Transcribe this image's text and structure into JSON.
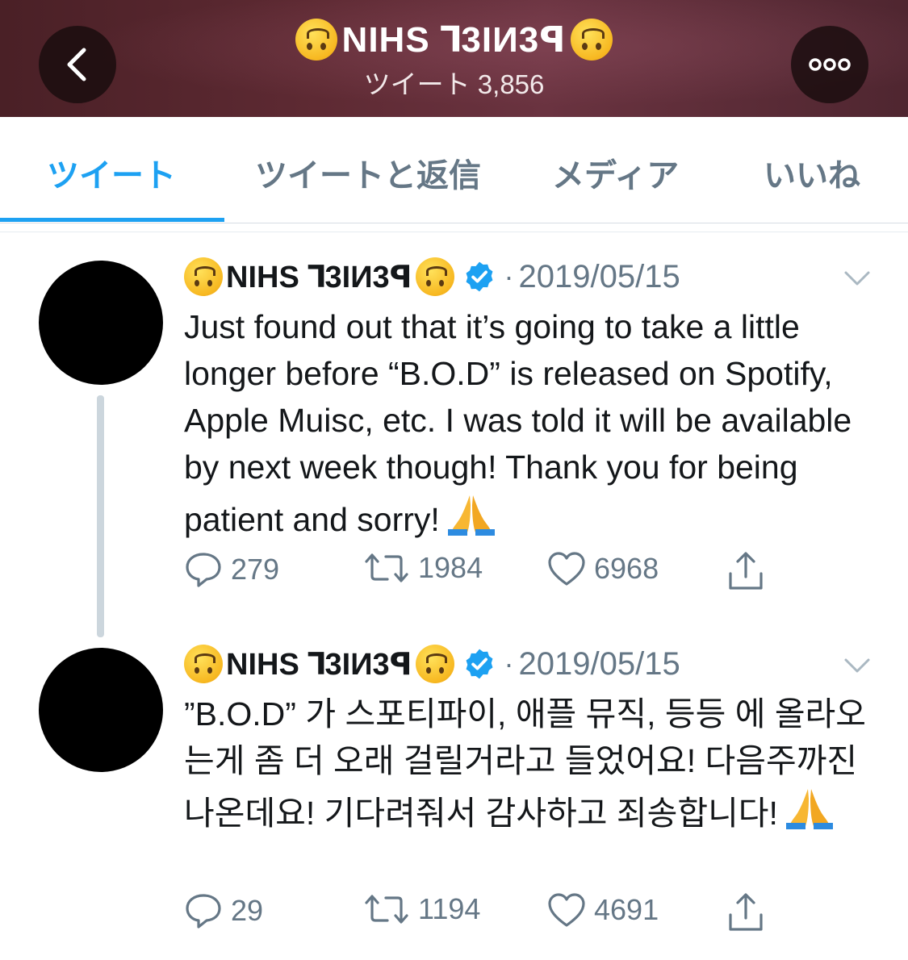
{
  "header": {
    "display_name": "NIHS ꓶ3IИ3ꟼ",
    "subtitle": "ツイート 3,856"
  },
  "tabs": [
    {
      "label": "ツイート",
      "active": true
    },
    {
      "label": "ツイートと返信",
      "active": false
    },
    {
      "label": "メディア",
      "active": false
    },
    {
      "label": "いいね",
      "active": false
    }
  ],
  "tweets": [
    {
      "name": "NIHS ꓶ3IИ3ꟼ",
      "separator": "·",
      "date": "2019/05/15",
      "text": "Just found out that it’s going to take a little longer before “B.O.D” is released on Spotify, Apple Muisc, etc. I was told it will be available by next week though! Thank you for being patient and sorry!",
      "replies": "279",
      "retweets": "1984",
      "likes": "6968"
    },
    {
      "name": "NIHS ꓶ3IИ3ꟼ",
      "separator": "·",
      "date": "2019/05/15",
      "text": "”B.O.D” 가 스포티파이, 애플 뮤직, 등등 에 올라오는게 좀 더 오래 걸릴거라고 들었어요! 다음주까진 나온데요! 기다려줘서 감사하고 죄송합니다!",
      "replies": "29",
      "retweets": "1194",
      "likes": "4691"
    }
  ],
  "icons": {
    "back": "chevron-left-icon",
    "more": "more-dots-icon",
    "emoji": "upside-down-face-emoji",
    "verified": "verified-badge-icon",
    "caret": "chevron-down-icon",
    "reply": "reply-icon",
    "retweet": "retweet-icon",
    "like": "heart-icon",
    "share": "share-icon",
    "pray": "folded-hands-emoji"
  },
  "colors": {
    "accent": "#1da1f2",
    "secondary_text": "#657786",
    "header_bg": "#5e2a33"
  }
}
